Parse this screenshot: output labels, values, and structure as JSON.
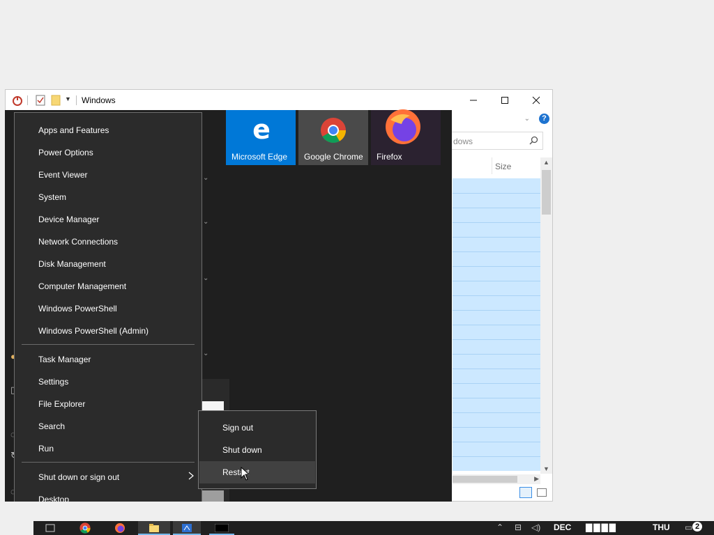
{
  "explorer": {
    "title": "Windows",
    "search_placeholder": "dows",
    "column_size": "Size",
    "help": "?",
    "caption": {
      "minimize": "—",
      "maximize": "☐",
      "close": "✕"
    }
  },
  "tiles": [
    {
      "label": "Microsoft Edge",
      "color": "#0078d7"
    },
    {
      "label": "Google Chrome",
      "color": "#4a4a4a"
    },
    {
      "label": "Firefox",
      "color": "#2b2230"
    }
  ],
  "winx_menu": {
    "group1": [
      "Apps and Features",
      "Power Options",
      "Event Viewer",
      "System",
      "Device Manager",
      "Network Connections",
      "Disk Management",
      "Computer Management",
      "Windows PowerShell",
      "Windows PowerShell (Admin)"
    ],
    "group2": [
      "Task Manager",
      "Settings",
      "File Explorer",
      "Search",
      "Run"
    ],
    "shutdown": "Shut down or sign out",
    "desktop": "Desktop"
  },
  "submenu": {
    "items": [
      "Sign out",
      "Shut down",
      "Restart"
    ]
  },
  "taskbar": {
    "month": "DEC",
    "day": "THU",
    "notifications": "2"
  },
  "colors": {
    "accent": "#0078d7",
    "menu_bg": "#2b2b2b",
    "selection": "#cce8ff"
  }
}
